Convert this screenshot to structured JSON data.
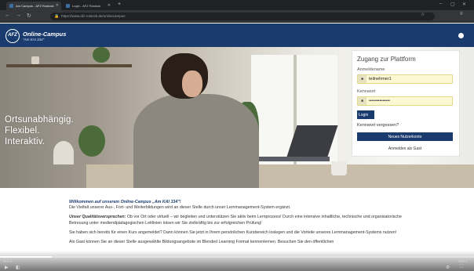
{
  "browser": {
    "tabs": [
      {
        "label": "Am Campus - AFZ Rostock",
        "active": true
      },
      {
        "label": "Login - AFZ Rostock",
        "active": false
      }
    ],
    "new_tab_glyph": "+",
    "url": "https://www.afz-rostock.de/onlinecampus",
    "window_controls": {
      "minimize": "–",
      "maximize": "▢",
      "close": "✕"
    }
  },
  "site": {
    "logo_text": "AFZ",
    "brand_title": "Online-Campus",
    "brand_subtitle": "\"Am KAI 334\""
  },
  "hero": {
    "tagline": [
      "Ortsunabhängig.",
      "Flexibel.",
      "Interaktiv."
    ]
  },
  "login": {
    "title": "Zugang zur Plattform",
    "username_label": "Anmeldename",
    "username_value": "teilnehmer1",
    "password_label": "Kennwort",
    "password_value": "••••••••••••••",
    "login_button": "Login",
    "forgot_link": "Kennwort vergessen?",
    "new_account_button": "Neues Nutzerkonto",
    "guest_link": "Anmelden als Gast"
  },
  "content": {
    "welcome_title": "Willkommen auf unserem Online-Campus „Am KAI 334\"!",
    "welcome_text": "Die Vielfalt unserer Aus-, Fort- und Weiterbildungen wird an dieser Stelle durch unser Lernmanagement-System ergänzt.",
    "promise_title": "Unser Qualitätsversprechen:",
    "promise_text": " Ob vor Ort oder virtuell – wir begleiten und unterstützen Sie aktiv beim Lernprozess! Durch eine intensive inhaltliche, technische und organisatorische Betreuung unter mediendpädagogischen Leitlinien lotsen wir Sie zielkräftig bis zur erfolgreichen Prüfung!",
    "para3": "Sie haben sich bereits für einen Kurs angemeldet? Dann können Sie jetzt in Ihrem persönlichen Kursbereich loslegen und die Vorteile unseres Lernmanagement-Systems nutzen!",
    "para4": "Als Gast können Sie an dieser Stelle ausgewählte Bildungsangebote im Blended Learning Format kennenlernen. Besuchen Sie den öffentlichen"
  },
  "video": {
    "time_left": "00:1:0",
    "time_right": "00:5:0",
    "progress_fraction": 0.11,
    "icons": [
      "play-icon",
      "volume-icon",
      "settings-icon",
      "fullscreen-icon"
    ]
  }
}
